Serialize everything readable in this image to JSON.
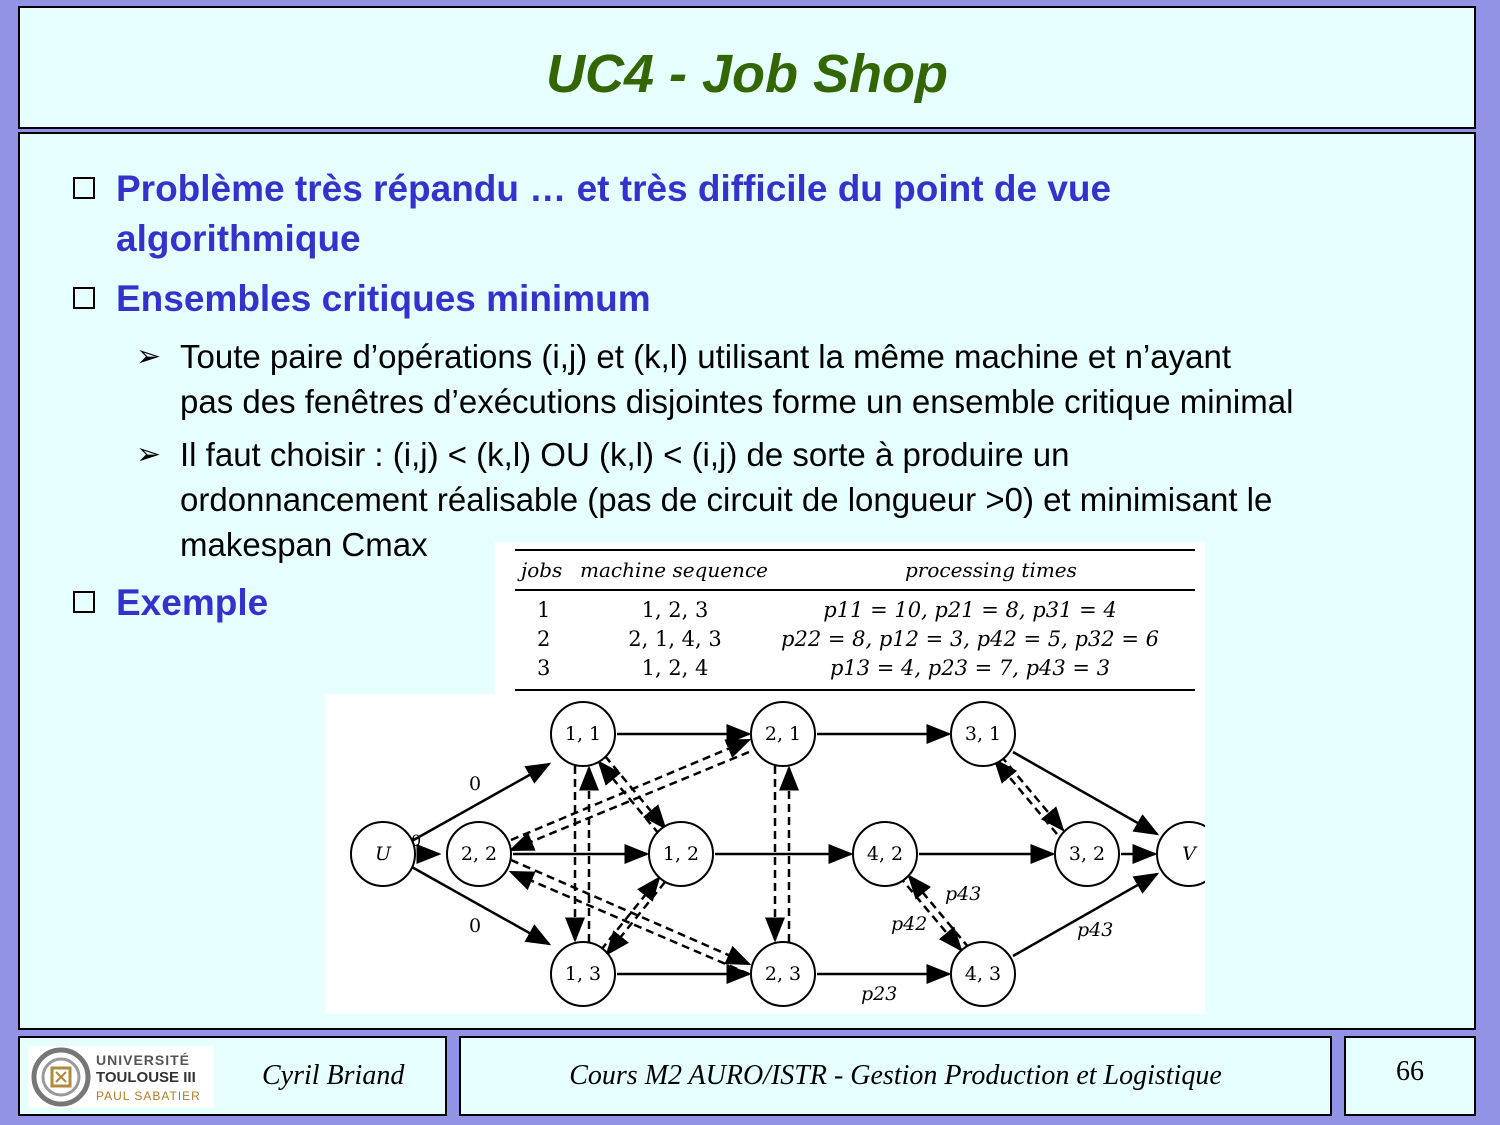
{
  "title": "UC4 - Job Shop",
  "bullets": [
    {
      "line1": "Problème très répandu … et très difficile du point de vue",
      "line2": "algorithmique"
    },
    {
      "line1": "Ensembles critiques minimum"
    }
  ],
  "sub_bullets": [
    {
      "line1": "Toute paire d’opérations (i,j) et (k,l) utilisant la même machine et n’ayant",
      "line2": "pas des fenêtres d’exécutions disjointes forme un ensemble critique minimal"
    },
    {
      "line1": "Il faut choisir : (i,j) < (k,l) OU (k,l) < (i,j) de sorte à produire un",
      "line2": "ordonnancement réalisable (pas de circuit de longueur >0) et minimisant le",
      "line3": "makespan Cmax"
    }
  ],
  "example_label": "Exemple",
  "table": {
    "headers": [
      "jobs",
      "machine sequence",
      "processing times"
    ],
    "rows": [
      {
        "job": "1",
        "seq": "1, 2, 3",
        "times": "p11 = 10,   p21 = 8,   p31 = 4"
      },
      {
        "job": "2",
        "seq": "2, 1, 4, 3",
        "times": "p22 = 8,   p12 = 3,   p42 = 5,   p32 = 6"
      },
      {
        "job": "3",
        "seq": "1, 2, 4",
        "times": "p13 = 4,   p23 = 7,   p43 = 3"
      }
    ]
  },
  "graph": {
    "nodes": [
      "U",
      "1, 1",
      "2, 1",
      "3, 1",
      "2, 2",
      "1, 2",
      "4, 2",
      "3, 2",
      "V",
      "1, 3",
      "2, 3",
      "4, 3"
    ],
    "edge_labels": [
      "0",
      "0",
      "0",
      "p43",
      "p42",
      "p43",
      "p23"
    ]
  },
  "footer": {
    "logo_line1": "UNIVERSITÉ",
    "logo_line2": "TOULOUSE III",
    "logo_line3": "PAUL SABATIER",
    "author": "Cyril Briand",
    "course": "Cours M2 AURO/ISTR - Gestion Production et Logistique",
    "page": "66"
  },
  "colors": {
    "background": "#9393e6",
    "panel": "#e6ffff",
    "title": "#336600",
    "bullet": "#3333cc"
  }
}
